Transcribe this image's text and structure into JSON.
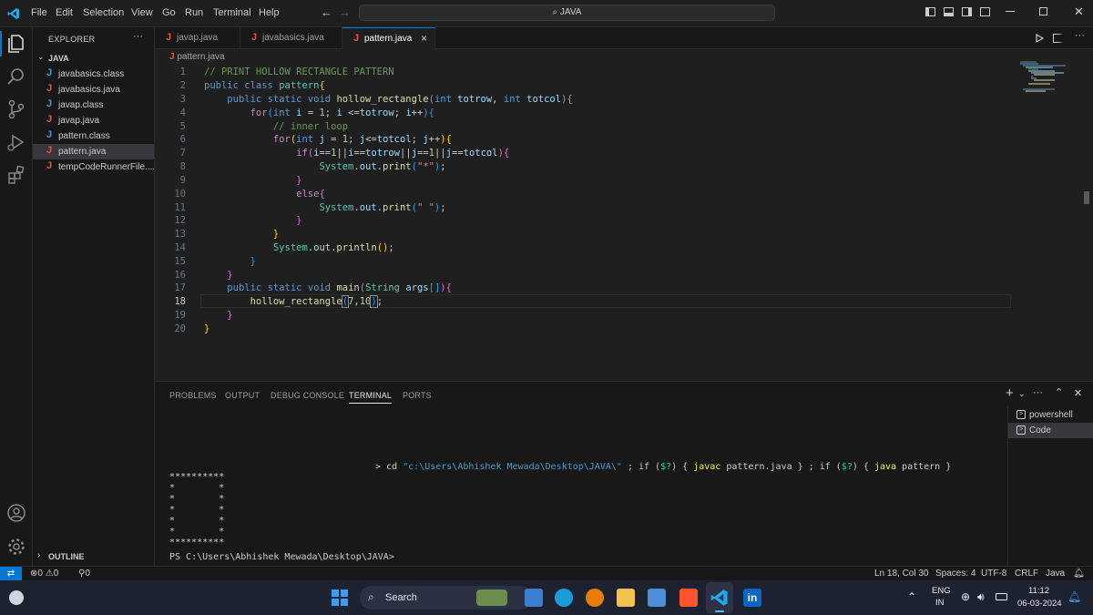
{
  "menu": [
    "File",
    "Edit",
    "Selection",
    "View",
    "Go",
    "Run",
    "Terminal",
    "Help"
  ],
  "command_center": {
    "label": "JAVA"
  },
  "explorer": {
    "title": "EXPLORER",
    "more": "···",
    "folder": "JAVA",
    "files": [
      {
        "name": "javabasics.class",
        "icon": "J"
      },
      {
        "name": "javabasics.java",
        "icon": "J"
      },
      {
        "name": "javap.class",
        "icon": "J"
      },
      {
        "name": "javap.java",
        "icon": "J"
      },
      {
        "name": "pattern.class",
        "icon": "J"
      },
      {
        "name": "pattern.java",
        "icon": "J"
      },
      {
        "name": "tempCodeRunnerFile....",
        "icon": "J"
      }
    ],
    "outline": "OUTLINE"
  },
  "tabs": [
    {
      "label": "javap.java"
    },
    {
      "label": "javabasics.java"
    },
    {
      "label": "pattern.java"
    }
  ],
  "breadcrumb": "pattern.java",
  "code": {
    "line_numbers": [
      "1",
      "2",
      "3",
      "4",
      "5",
      "6",
      "7",
      "8",
      "9",
      "10",
      "11",
      "12",
      "13",
      "14",
      "15",
      "16",
      "17",
      "18",
      "19",
      "20"
    ],
    "line1": "// PRINT HOLLOW RECTANGLE PATTERN",
    "line5": "// inner loop"
  },
  "panel": {
    "tabs": [
      "PROBLEMS",
      "OUTPUT",
      "DEBUG CONSOLE",
      "TERMINAL",
      "PORTS"
    ],
    "command": "> cd \"c:\\Users\\Abhishek Mewada\\Desktop\\JAVA\\\" ; if ($?) { javac pattern.java } ; if ($?) { java pattern }",
    "output": [
      "**********",
      "*        *",
      "*        *",
      "*        *",
      "*        *",
      "*        *",
      "**********"
    ],
    "prompt": "PS C:\\Users\\Abhishek Mewada\\Desktop\\JAVA>",
    "terminals": [
      "powershell",
      "Code"
    ],
    "add": "+",
    "more": "···"
  },
  "status": {
    "errors": "0",
    "warnings": "0",
    "ports": "0",
    "position": "Ln 18, Col 30",
    "spaces": "Spaces: 4",
    "encoding": "UTF-8",
    "eol": "CRLF",
    "language": "Java"
  },
  "taskbar": {
    "search": "Search",
    "lang1": "ENG",
    "lang2": "IN",
    "time": "11:12",
    "date": "06-03-2024"
  },
  "colors": {
    "accent": "#0078d4",
    "java_icon": "#f14c4c",
    "java_blue": "#3b9cd9"
  }
}
